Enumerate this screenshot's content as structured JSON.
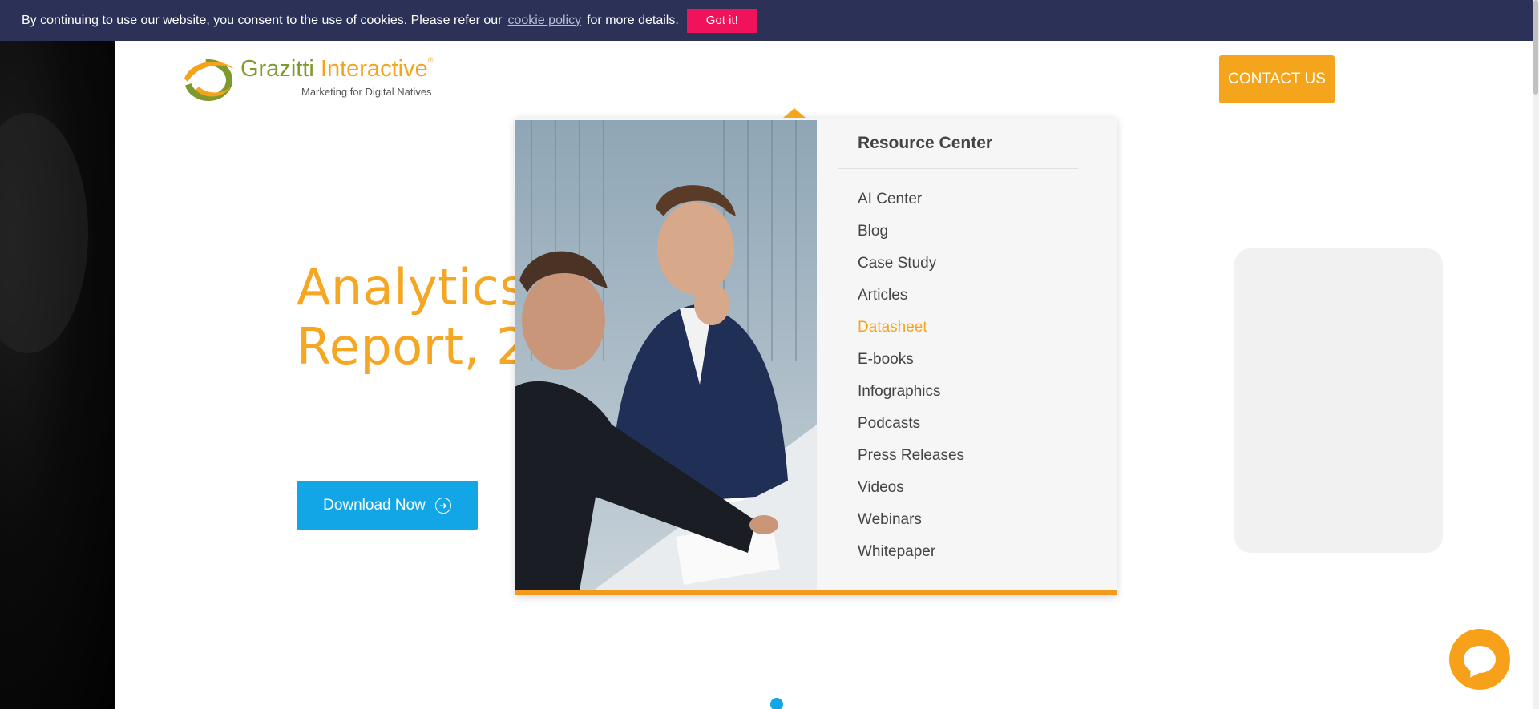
{
  "cookie_bar": {
    "text_before": "By continuing to use our website, you consent to the use of cookies. Please refer our",
    "link_text": "cookie policy",
    "text_after": "for more details.",
    "button_label": "Got it!"
  },
  "header": {
    "logo_name_part1": "Grazitti",
    "logo_name_part2": "Interactive",
    "logo_registered": "®",
    "logo_tagline": "Marketing for Digital Natives",
    "contact_label": "CONTACT US"
  },
  "hero": {
    "title_line1": "Analytics C",
    "title_line2": "Report, 20",
    "download_label": "Download Now",
    "download_icon": "arrow-circle-right-icon"
  },
  "dropdown": {
    "title": "Resource Center",
    "items": [
      {
        "label": "AI Center"
      },
      {
        "label": "Blog"
      },
      {
        "label": "Case Study"
      },
      {
        "label": "Articles"
      },
      {
        "label": "Datasheet"
      },
      {
        "label": "E-books"
      },
      {
        "label": "Infographics"
      },
      {
        "label": "Podcasts"
      },
      {
        "label": "Press Releases"
      },
      {
        "label": "Videos"
      },
      {
        "label": "Webinars"
      },
      {
        "label": "Whitepaper"
      }
    ],
    "active_item": "Datasheet"
  },
  "colors": {
    "cookie_bar_bg": "#2b3157",
    "got_it_bg": "#f0135b",
    "brand_orange": "#f5a51c",
    "brand_green": "#7f9a2c",
    "cta_blue": "#12a6e6"
  },
  "chat": {
    "icon": "chat-bubble-icon"
  }
}
